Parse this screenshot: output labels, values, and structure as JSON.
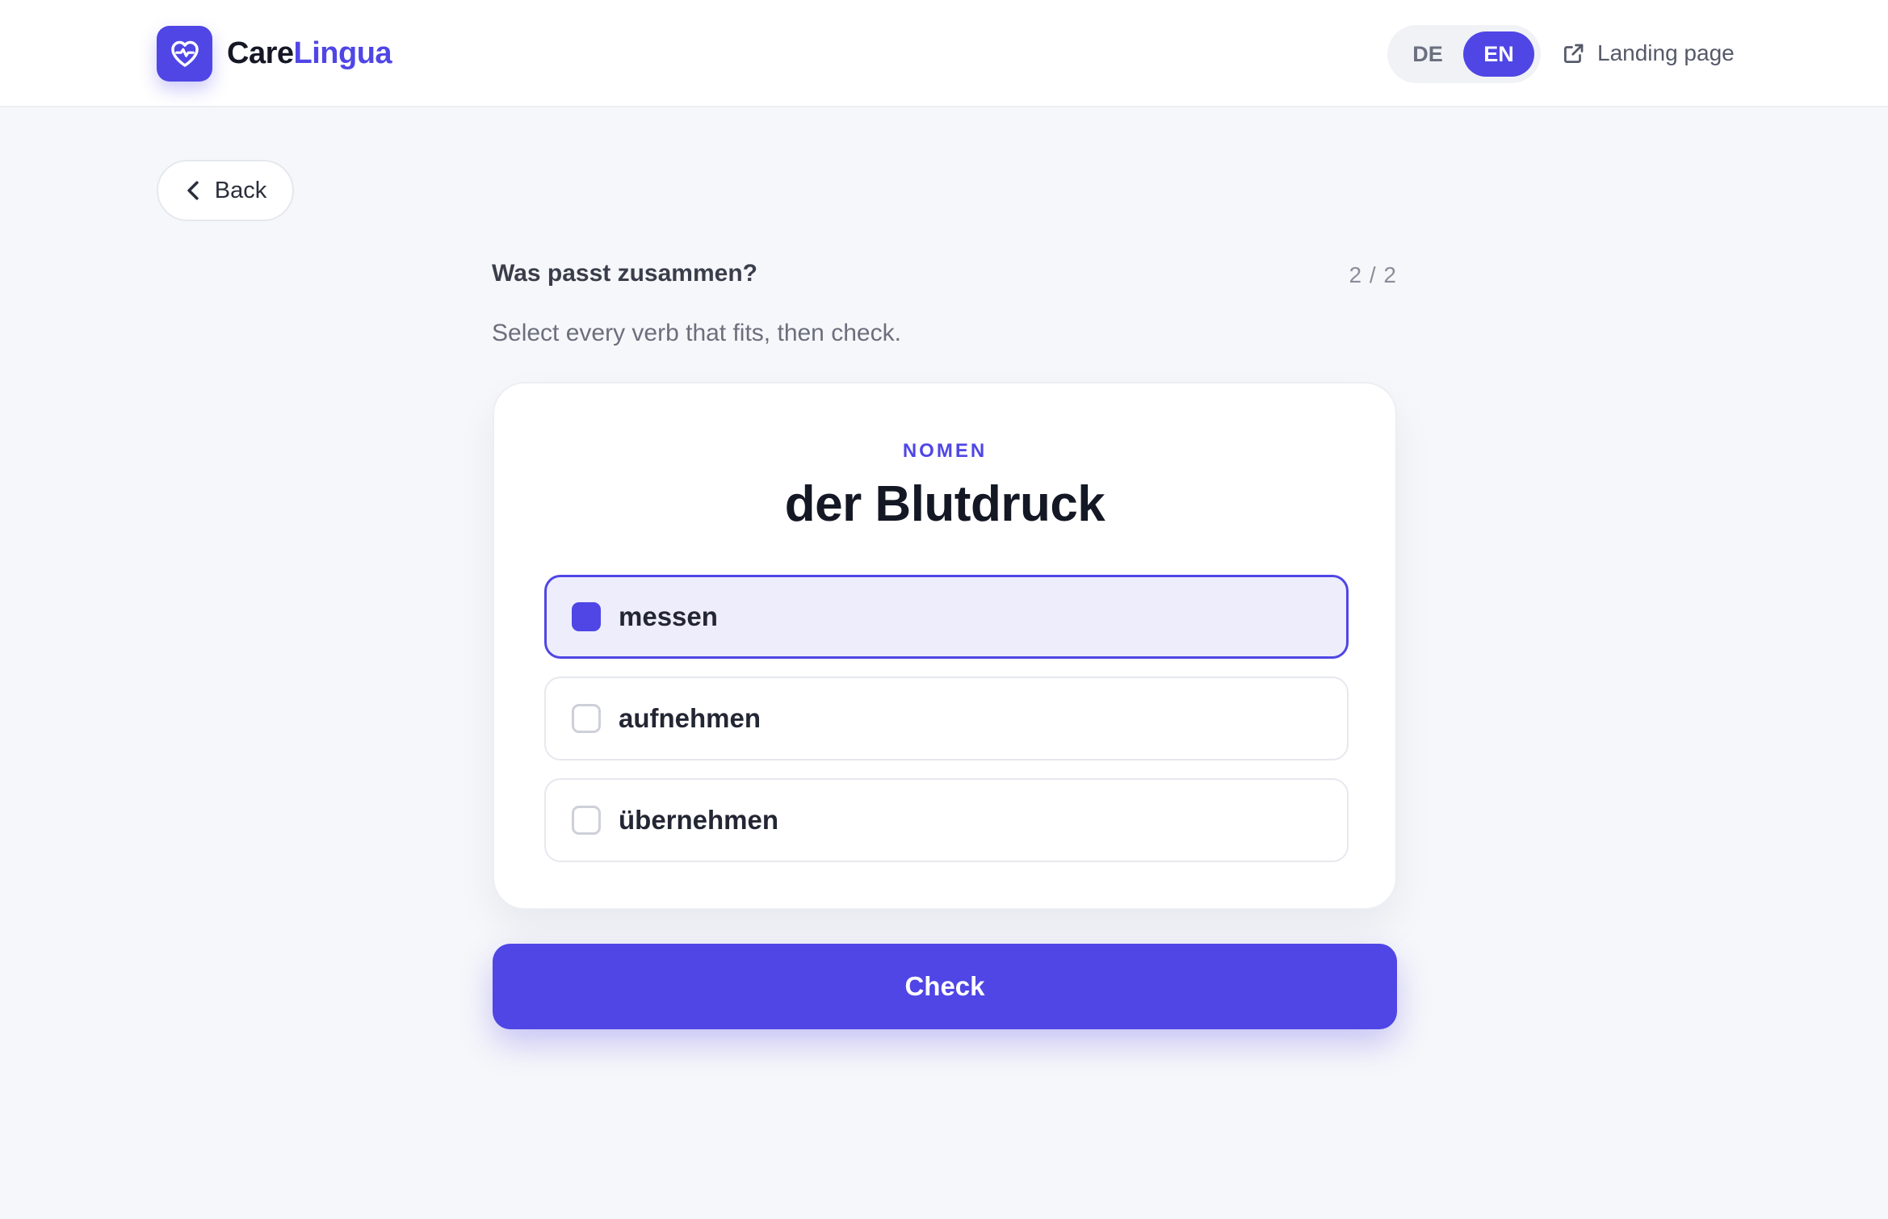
{
  "header": {
    "brand": {
      "part1": "Care",
      "part2": "Lingua",
      "logo_icon": "heart-pulse-icon"
    },
    "languages": [
      {
        "label": "DE",
        "active": false
      },
      {
        "label": "EN",
        "active": true
      }
    ],
    "landing_link": {
      "label": "Landing page",
      "icon": "external-link-icon"
    }
  },
  "nav": {
    "back_label": "Back",
    "back_icon": "chevron-left-icon"
  },
  "exercise": {
    "title": "Was passt zusammen?",
    "counter": "2 / 2",
    "instruction": "Select every verb that fits, then check.",
    "word_type": "NOMEN",
    "word": "der Blutdruck",
    "options": [
      {
        "label": "messen",
        "selected": true
      },
      {
        "label": "aufnehmen",
        "selected": false
      },
      {
        "label": "übernehmen",
        "selected": false
      }
    ],
    "check_label": "Check"
  },
  "colors": {
    "accent": "#4f46e5",
    "background": "#f6f7fa",
    "selected_option_bg": "#eeedfc"
  }
}
